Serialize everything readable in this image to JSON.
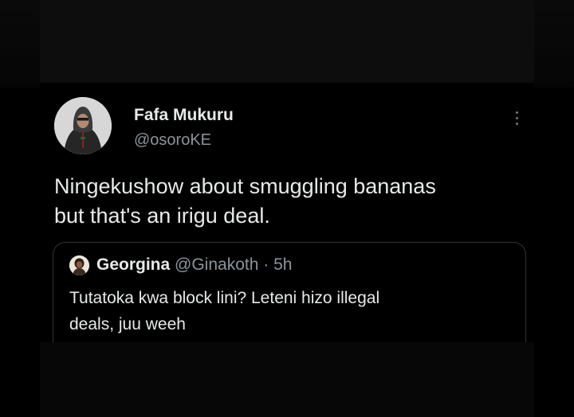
{
  "tweet": {
    "author_name": "Fafa Mukuru",
    "author_handle": "@osoroKE",
    "text_lines": [
      "Ningekushow about smuggling bananas",
      "but that's an irigu deal."
    ],
    "more_icon": "more-vertical-icon"
  },
  "quoted_tweet": {
    "author_name": "Georgina",
    "author_handle": "@Ginakoth",
    "separator": "·",
    "time": "5h",
    "text_lines": [
      "Tutatoka kwa block lini? Leteni hizo illegal",
      "deals, juu weeh"
    ]
  },
  "colors": {
    "background": "#000000",
    "text_primary": "#e7e9ea",
    "text_secondary": "#8b949c",
    "border": "#2f3336"
  }
}
